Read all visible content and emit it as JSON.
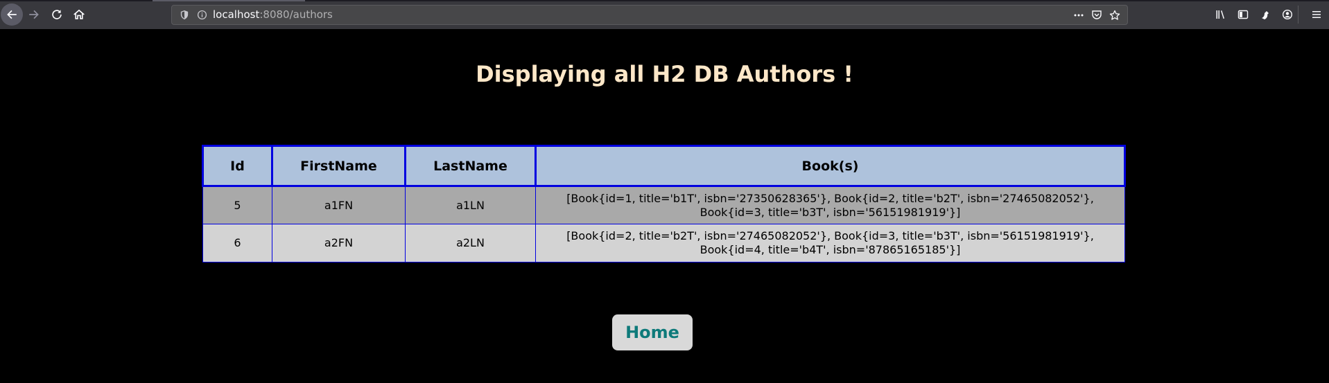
{
  "browser": {
    "url_host": "localhost",
    "url_rest": ":8080/authors",
    "icons": [
      "back-icon",
      "forward-icon",
      "reload-icon",
      "home-icon",
      "shield-icon",
      "info-icon",
      "more-icon",
      "pocket-icon",
      "star-icon",
      "library-icon",
      "sidebar-icon",
      "extension-icon",
      "account-icon",
      "menu-icon"
    ]
  },
  "page": {
    "title": "Displaying all H2 DB Authors !",
    "home_label": "Home"
  },
  "table": {
    "headers": [
      "Id",
      "FirstName",
      "LastName",
      "Book(s)"
    ],
    "rows": [
      {
        "id": "5",
        "first": "a1FN",
        "last": "a1LN",
        "books_line1": "[Book{id=1, title='b1T', isbn='27350628365'}, Book{id=2, title='b2T', isbn='27465082052'},",
        "books_line2": "Book{id=3, title='b3T', isbn='56151981919'}]"
      },
      {
        "id": "6",
        "first": "a2FN",
        "last": "a2LN",
        "books_line1": "[Book{id=2, title='b2T', isbn='27465082052'}, Book{id=3, title='b3T', isbn='56151981919'},",
        "books_line2": "Book{id=4, title='b4T', isbn='87865165185'}]"
      }
    ]
  },
  "colors": {
    "title": "#fde7c8",
    "header_bg": "#aec2dc",
    "border": "#0000e0",
    "row1_bg": "#a9a9a9",
    "row2_bg": "#d3d3d3",
    "home_text": "#0e7a7a"
  }
}
